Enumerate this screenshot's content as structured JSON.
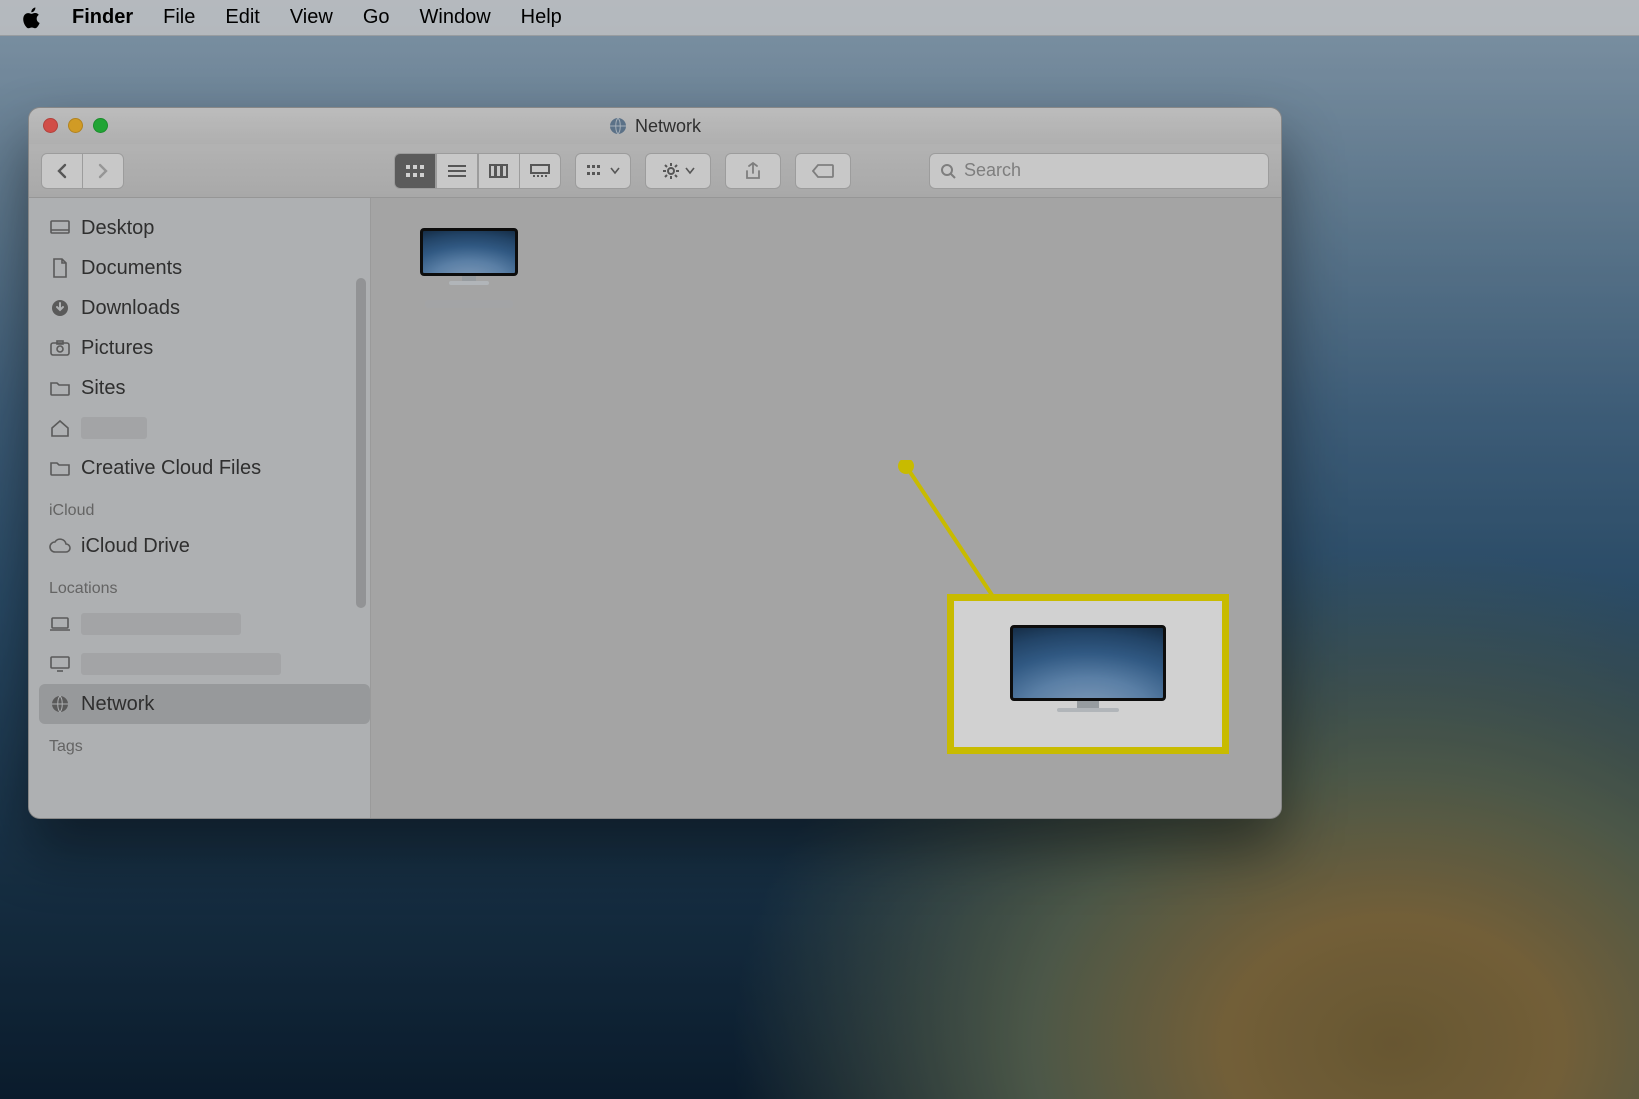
{
  "menubar": {
    "app": "Finder",
    "items": [
      "File",
      "Edit",
      "View",
      "Go",
      "Window",
      "Help"
    ]
  },
  "window": {
    "title": "Network",
    "search_placeholder": "Search"
  },
  "sidebar": {
    "favorites": [
      {
        "icon": "desktop-icon",
        "label": "Desktop"
      },
      {
        "icon": "documents-icon",
        "label": "Documents"
      },
      {
        "icon": "downloads-icon",
        "label": "Downloads"
      },
      {
        "icon": "pictures-icon",
        "label": "Pictures"
      },
      {
        "icon": "folder-icon",
        "label": "Sites"
      },
      {
        "icon": "home-icon",
        "label": "",
        "blurred": true
      },
      {
        "icon": "folder-icon",
        "label": "Creative Cloud Files"
      }
    ],
    "groups": [
      {
        "title": "iCloud",
        "items": [
          {
            "icon": "cloud-icon",
            "label": "iCloud Drive"
          }
        ]
      },
      {
        "title": "Locations",
        "items": [
          {
            "icon": "laptop-icon",
            "label": "",
            "blurred": true
          },
          {
            "icon": "display-icon",
            "label": "",
            "blurred": true
          },
          {
            "icon": "network-globe-icon",
            "label": "Network",
            "selected": true
          }
        ]
      },
      {
        "title": "Tags",
        "items": []
      }
    ]
  },
  "content": {
    "items": [
      {
        "kind": "network-mac",
        "label": "",
        "blurred": true
      }
    ]
  }
}
